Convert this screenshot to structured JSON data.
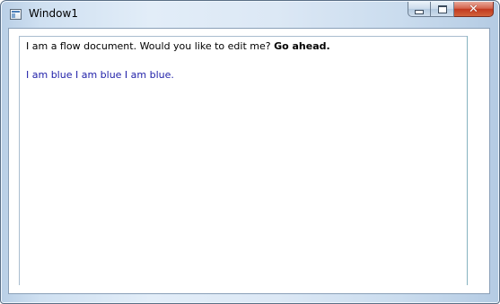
{
  "window": {
    "title": "Window1",
    "icon": "app-window-icon",
    "buttons": {
      "minimize": "minimize-icon",
      "maximize": "maximize-icon",
      "close": "close-icon"
    }
  },
  "document": {
    "paragraph1_text": "I am a flow document. Would you like to edit me? ",
    "paragraph1_bold": "Go ahead.",
    "paragraph2_text": "I am blue I am blue I am blue.",
    "paragraph2_color": "#1f1fa8"
  }
}
